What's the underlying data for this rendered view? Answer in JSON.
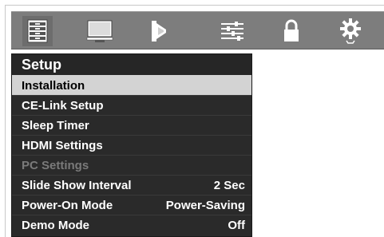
{
  "topbar": {
    "tabs": [
      {
        "icon": "picture-list-icon"
      },
      {
        "icon": "monitor-icon"
      },
      {
        "icon": "speaker-icon"
      },
      {
        "icon": "sliders-icon"
      },
      {
        "icon": "lock-icon"
      },
      {
        "icon": "gear-icon"
      }
    ]
  },
  "menu": {
    "title": "Setup",
    "items": [
      {
        "label": "Installation",
        "value": "",
        "state": "selected"
      },
      {
        "label": "CE-Link Setup",
        "value": "",
        "state": "normal"
      },
      {
        "label": "Sleep Timer",
        "value": "",
        "state": "normal"
      },
      {
        "label": "HDMI Settings",
        "value": "",
        "state": "normal"
      },
      {
        "label": "PC Settings",
        "value": "",
        "state": "disabled"
      },
      {
        "label": "Slide Show Interval",
        "value": "2 Sec",
        "state": "normal"
      },
      {
        "label": "Power-On Mode",
        "value": "Power-Saving",
        "state": "normal"
      },
      {
        "label": "Demo Mode",
        "value": "Off",
        "state": "normal"
      }
    ]
  },
  "colors": {
    "topbar_bg": "#7d7d7d",
    "menu_bg": "#2a2a2a",
    "selected_bg": "#d3d3d3",
    "disabled_text": "#7a7a7a"
  }
}
